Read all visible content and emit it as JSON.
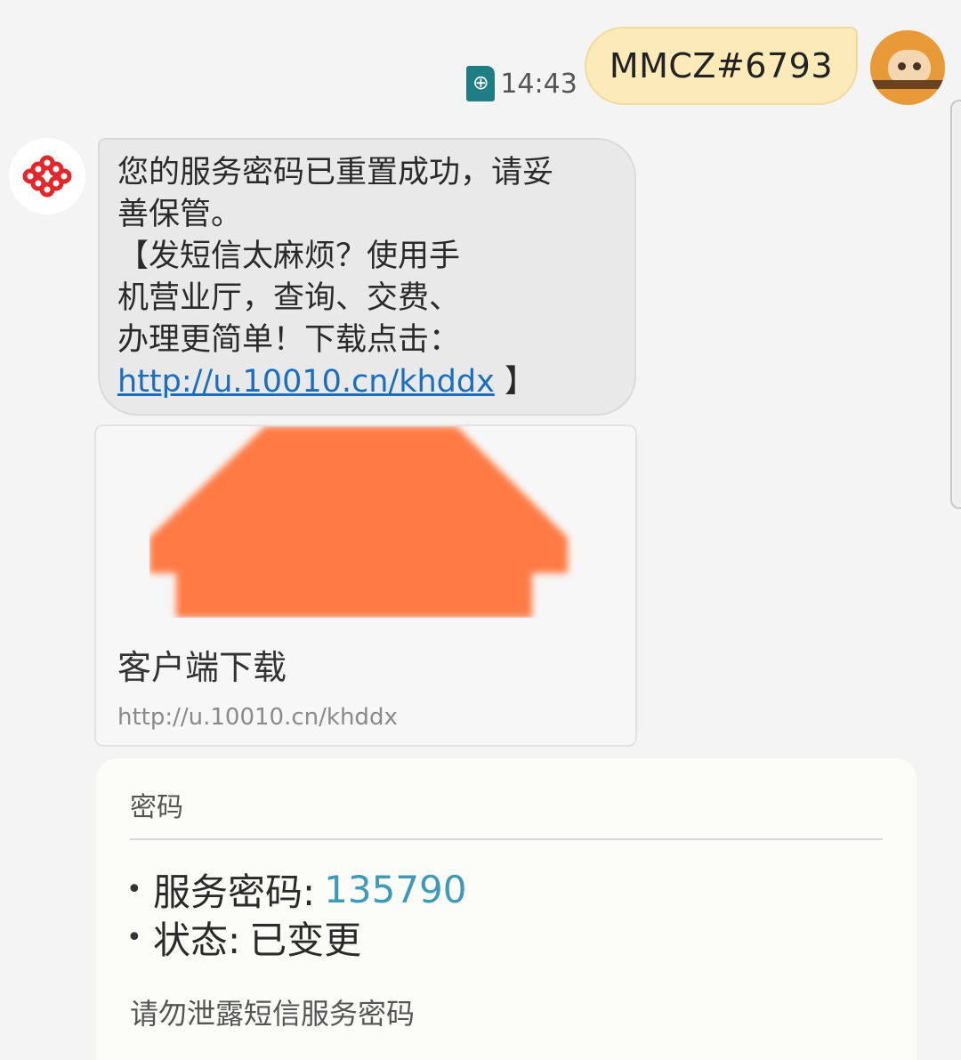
{
  "outgoing": {
    "time": "14:43",
    "text": "MMCZ#6793",
    "sim_icon": "globe-icon"
  },
  "incoming": {
    "lines": [
      "您的服务密码已重置成功，请妥",
      "善保管。",
      "【发短信太麻烦？使用手",
      "机营业厅，查询、交费、",
      "办理更简单！下载点击："
    ],
    "link_text": "http://u.10010.cn/khddx",
    "link_suffix": " 】"
  },
  "preview": {
    "title": "客户端下载",
    "url": "http://u.10010.cn/khddx"
  },
  "card": {
    "title": "密码",
    "bullet": "•",
    "items": [
      {
        "label": "服务密码:",
        "value": "135790"
      },
      {
        "label": "状态:",
        "value": "已变更"
      }
    ],
    "note": "请勿泄露短信服务密码"
  },
  "colors": {
    "outgoing_bubble": "#fcebb8",
    "incoming_bubble": "#e9e9e9",
    "link": "#1a6ec2",
    "accent_value": "#3d9ab8",
    "sender_logo": "#e3262a",
    "preview_image": "#ff7a45"
  }
}
